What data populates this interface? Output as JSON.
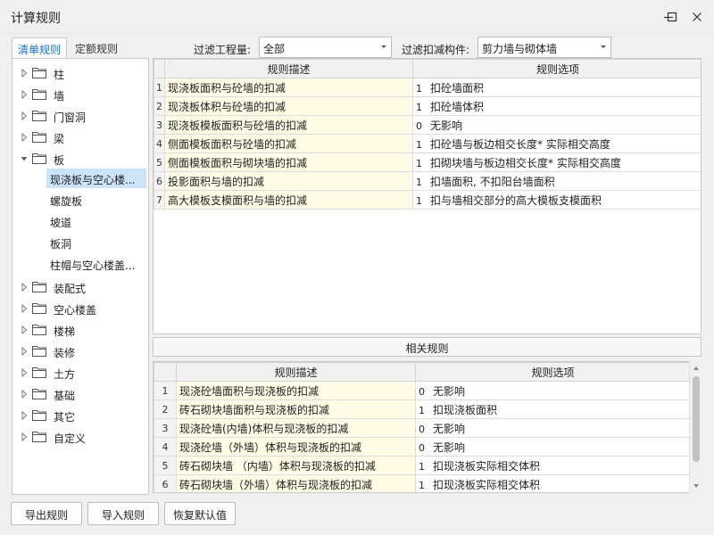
{
  "window": {
    "title": "计算规则"
  },
  "tabs": [
    {
      "label": "清单规则",
      "active": true
    },
    {
      "label": "定额规则",
      "active": false
    }
  ],
  "filters": {
    "quantity_label": "过滤工程量:",
    "quantity_value": "全部",
    "component_label": "过滤扣减构件:",
    "component_value": "剪力墙与砌体墙"
  },
  "tree": {
    "items": [
      {
        "label": "柱"
      },
      {
        "label": "墙"
      },
      {
        "label": "门窗洞"
      },
      {
        "label": "梁"
      },
      {
        "label": "板",
        "expanded": true,
        "children": [
          {
            "label": "现浇板与空心楼...",
            "selected": true
          },
          {
            "label": "螺旋板"
          },
          {
            "label": "坡道"
          },
          {
            "label": "板洞"
          },
          {
            "label": "柱帽与空心楼盖..."
          }
        ]
      },
      {
        "label": "装配式"
      },
      {
        "label": "空心楼盖"
      },
      {
        "label": "楼梯"
      },
      {
        "label": "装修"
      },
      {
        "label": "土方"
      },
      {
        "label": "基础"
      },
      {
        "label": "其它"
      },
      {
        "label": "自定义"
      }
    ]
  },
  "main_grid": {
    "headers": [
      "规则描述",
      "规则选项"
    ],
    "rows": [
      {
        "index": "1",
        "desc": "现浇板面积与砼墙的扣减",
        "code": "1",
        "option": "扣砼墙面积"
      },
      {
        "index": "2",
        "desc": "现浇板体积与砼墙的扣减",
        "code": "1",
        "option": "扣砼墙体积"
      },
      {
        "index": "3",
        "desc": "现浇板模板面积与砼墙的扣减",
        "code": "0",
        "option": "无影响"
      },
      {
        "index": "4",
        "desc": "侧面模板面积与砼墙的扣减",
        "code": "1",
        "option": "扣砼墙与板边相交长度* 实际相交高度"
      },
      {
        "index": "5",
        "desc": "侧面模板面积与砌块墙的扣减",
        "code": "1",
        "option": "扣砌块墙与板边相交长度* 实际相交高度"
      },
      {
        "index": "6",
        "desc": "投影面积与墙的扣减",
        "code": "1",
        "option": "扣墙面积, 不扣阳台墙面积"
      },
      {
        "index": "7",
        "desc": "高大模板支模面积与墙的扣减",
        "code": "1",
        "option": "扣与墙相交部分的高大模板支模面积"
      }
    ]
  },
  "related": {
    "title": "相关规则",
    "headers": [
      "规则描述",
      "规则选项"
    ],
    "rows": [
      {
        "index": "1",
        "desc": "现浇砼墙面积与现浇板的扣减",
        "code": "0",
        "option": "无影响"
      },
      {
        "index": "2",
        "desc": "砖石砌块墙面积与现浇板的扣减",
        "code": "1",
        "option": "扣现浇板面积"
      },
      {
        "index": "3",
        "desc": "现浇砼墙(内墙)体积与现浇板的扣减",
        "code": "0",
        "option": "无影响"
      },
      {
        "index": "4",
        "desc": "现浇砼墙（外墙）体积与现浇板的扣减",
        "code": "0",
        "option": "无影响"
      },
      {
        "index": "5",
        "desc": "砖石砌块墙 （内墙）体积与现浇板的扣减",
        "code": "1",
        "option": "扣现浇板实际相交体积"
      },
      {
        "index": "6",
        "desc": "砖石砌块墙（外墙）体积与现浇板的扣减",
        "code": "1",
        "option": "扣现浇板实际相交体积"
      }
    ]
  },
  "buttons": {
    "export": "导出规则",
    "import": "导入规则",
    "restore": "恢复默认值"
  },
  "colors": {
    "accent": "#1a6fd0",
    "desc_bg": "#fffbe5",
    "selected_bg": "#cce4f7"
  }
}
